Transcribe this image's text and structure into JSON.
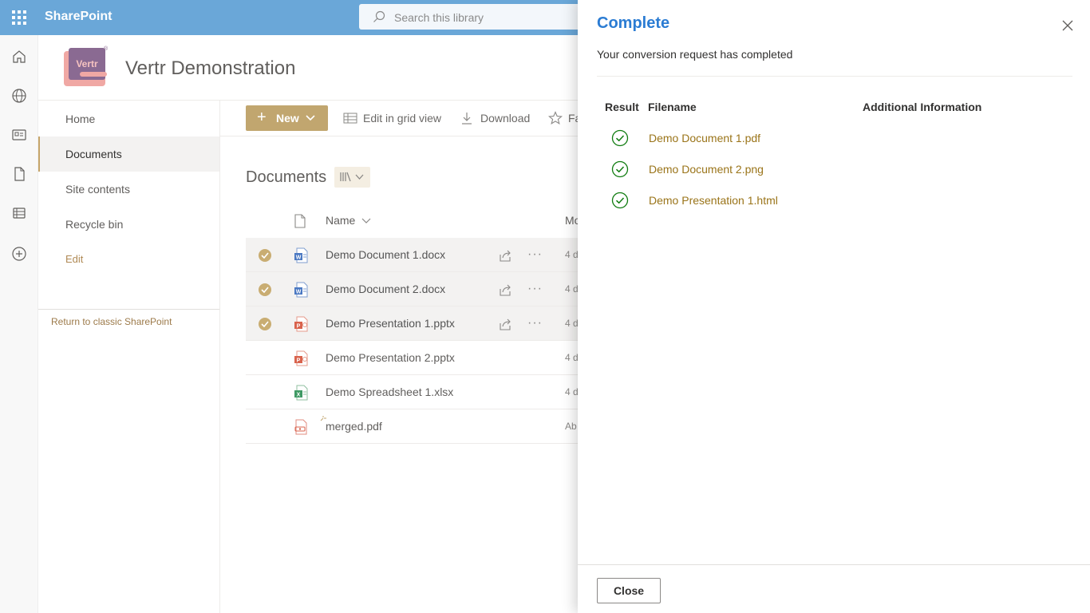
{
  "suitebar": {
    "app_name": "SharePoint",
    "search_placeholder": "Search this library"
  },
  "appbar": {
    "icons": [
      "home-icon",
      "globe-icon",
      "news-icon",
      "document-icon",
      "list-icon",
      "add-icon"
    ]
  },
  "site": {
    "logo_text": "Vertr",
    "logo_reg": "®",
    "title": "Vertr Demonstration"
  },
  "nav": {
    "items": [
      {
        "label": "Home"
      },
      {
        "label": "Documents"
      },
      {
        "label": "Site contents"
      },
      {
        "label": "Recycle bin"
      },
      {
        "label": "Edit"
      }
    ],
    "classic_link": "Return to classic SharePoint"
  },
  "commandbar": {
    "new_label": "New",
    "grid_label": "Edit in grid view",
    "download_label": "Download",
    "favorite_label": "Fa"
  },
  "library": {
    "title": "Documents",
    "name_header": "Name",
    "modified_header": "Mo",
    "files": [
      {
        "name": "Demo Document 1.docx",
        "modified": "4 d",
        "type": "word",
        "selected": true
      },
      {
        "name": "Demo Document 2.docx",
        "modified": "4 d",
        "type": "word",
        "selected": true
      },
      {
        "name": "Demo Presentation 1.pptx",
        "modified": "4 d",
        "type": "powerpoint",
        "selected": true
      },
      {
        "name": "Demo Presentation 2.pptx",
        "modified": "4 d",
        "type": "powerpoint",
        "selected": false
      },
      {
        "name": "Demo Spreadsheet 1.xlsx",
        "modified": "4 d",
        "type": "excel",
        "selected": false
      },
      {
        "name": "merged.pdf",
        "modified": "Ab",
        "type": "pdf",
        "selected": false
      }
    ]
  },
  "panel": {
    "title": "Complete",
    "subtitle": "Your conversion request has completed",
    "headers": {
      "result": "Result",
      "filename": "Filename",
      "info": "Additional Information"
    },
    "results": [
      {
        "filename": "Demo Document 1.pdf",
        "info": ""
      },
      {
        "filename": "Demo Document 2.png",
        "info": ""
      },
      {
        "filename": "Demo Presentation 1.html",
        "info": ""
      }
    ],
    "close_label": "Close"
  },
  "colors": {
    "suitebar": "#6aa7d8",
    "accent": "#c1a66f",
    "panel_title": "#2b7cd3",
    "link": "#9a7419",
    "success": "#107c10"
  }
}
